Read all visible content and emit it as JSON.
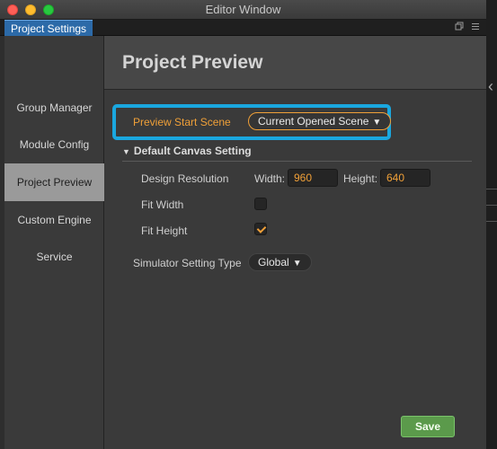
{
  "window": {
    "title": "Editor Window",
    "tab_label": "Project Settings",
    "tab_icons": [
      "restore-window-icon",
      "menu-icon"
    ]
  },
  "sidebar": {
    "items": [
      {
        "label": "Group Manager",
        "active": false
      },
      {
        "label": "Module Config",
        "active": false
      },
      {
        "label": "Project Preview",
        "active": true
      },
      {
        "label": "Custom Engine",
        "active": false
      },
      {
        "label": "Service",
        "active": false
      }
    ]
  },
  "main": {
    "title": "Project Preview",
    "preview_start_scene": {
      "label": "Preview Start Scene",
      "value": "Current Opened Scene",
      "arrow": "▼"
    },
    "canvas_section": {
      "toggle": "▼",
      "title": "Default Canvas Setting",
      "design_resolution": {
        "label": "Design Resolution",
        "width_label": "Width:",
        "width_value": "960",
        "height_label": "Height:",
        "height_value": "640"
      },
      "fit_width": {
        "label": "Fit Width",
        "checked": false
      },
      "fit_height": {
        "label": "Fit Height",
        "checked": true
      }
    },
    "simulator": {
      "label": "Simulator Setting Type",
      "value": "Global",
      "arrow": "▼"
    },
    "save_label": "Save"
  },
  "colors": {
    "accent_orange": "#f0a038",
    "highlight_blue": "#1aa7df",
    "tab_blue": "#2c6aa8",
    "save_green": "#5b9a4b"
  }
}
